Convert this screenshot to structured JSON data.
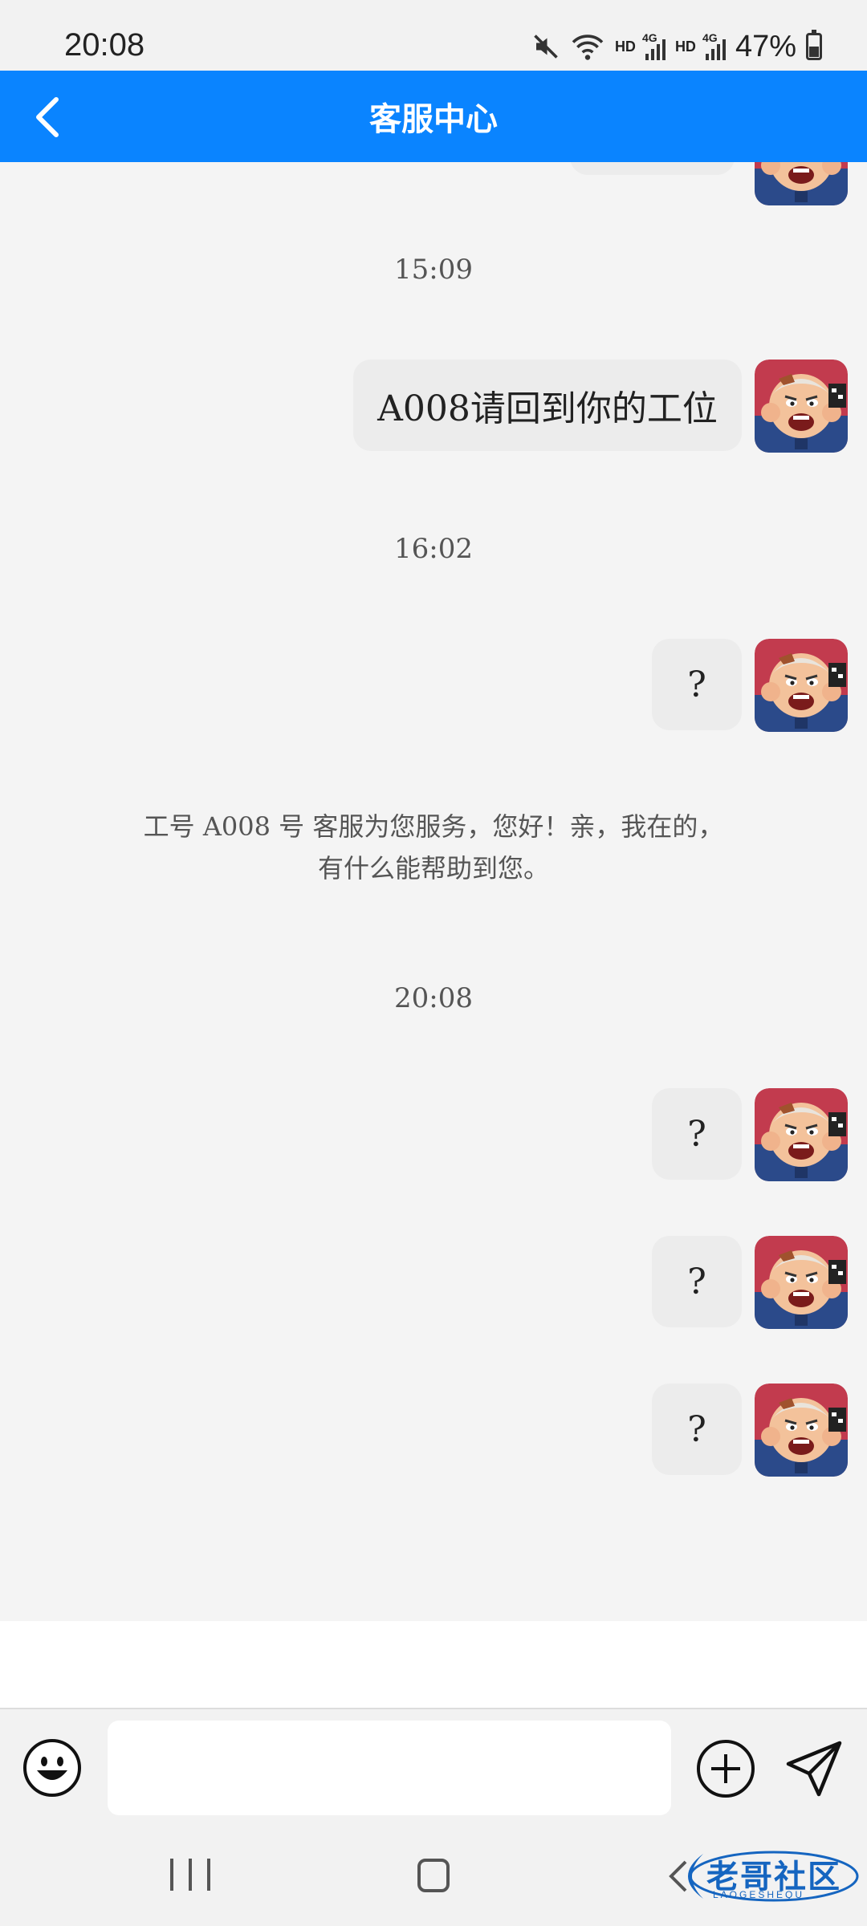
{
  "status_bar": {
    "time": "20:08",
    "hd1": "HD",
    "net1": "4G",
    "hd2": "HD",
    "net2": "4G",
    "battery": "47%",
    "icons": [
      "mute-icon",
      "wifi-icon",
      "signal-icon",
      "signal-icon",
      "battery-icon"
    ]
  },
  "header": {
    "title": "客服中心",
    "background": "#0a84ff"
  },
  "messages": {
    "t1": "15:09",
    "m1": "A008请回到你的工位",
    "t2": "16:02",
    "m2": "?",
    "system_line1": "工号 A008 号 客服为您服务，您好！亲，我在的，",
    "system_line2": "有什么能帮助到您。",
    "t3": "20:08",
    "m3": "?",
    "m4": "?",
    "m5": "?"
  },
  "composer": {
    "input_value": "",
    "icons": [
      "emoji-icon",
      "plus-circle-icon",
      "send-icon"
    ]
  },
  "watermark": {
    "text": "老哥社区",
    "sub": "LAOGESHEQU"
  }
}
